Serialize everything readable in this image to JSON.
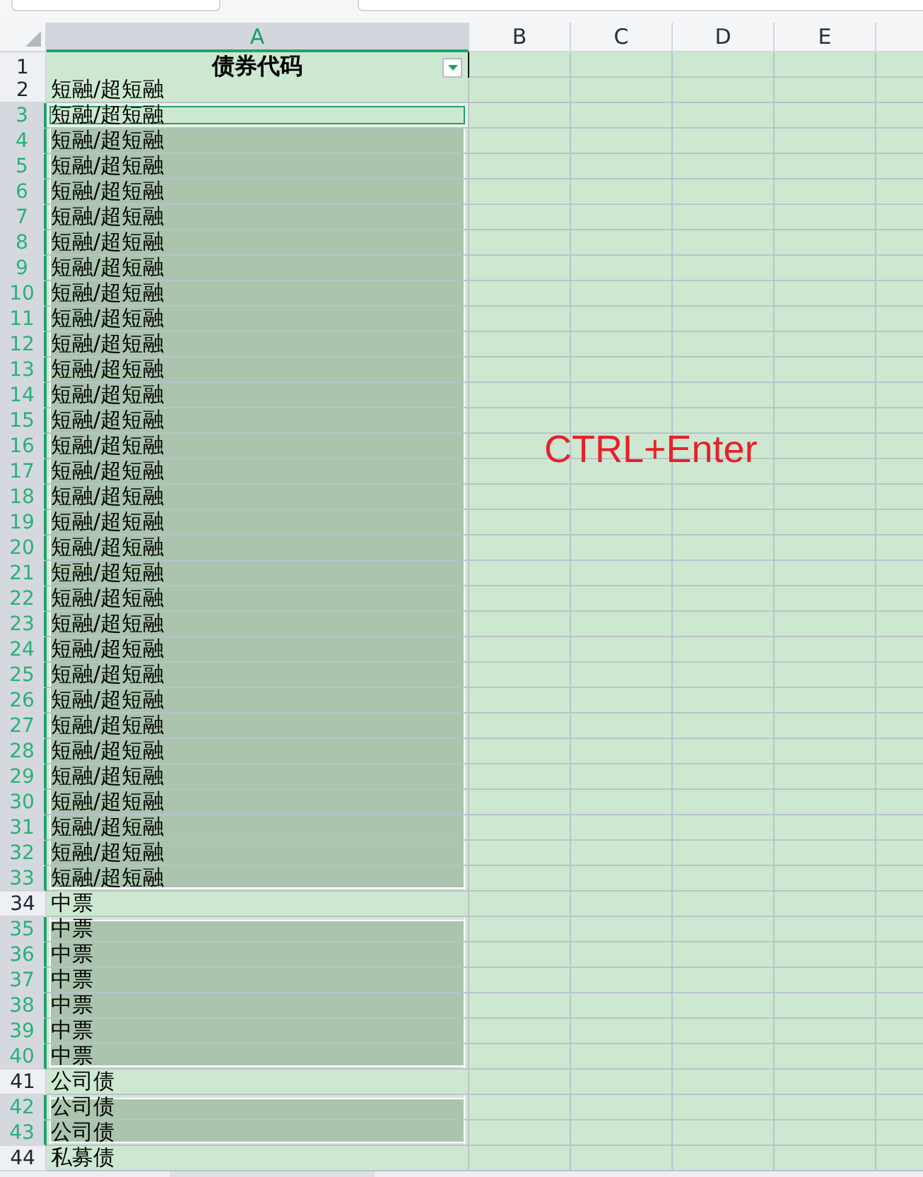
{
  "columns": [
    {
      "label": "A",
      "selected": true
    },
    {
      "label": "B",
      "selected": false
    },
    {
      "label": "C",
      "selected": false
    },
    {
      "label": "D",
      "selected": false
    },
    {
      "label": "E",
      "selected": false
    }
  ],
  "header_row": {
    "number": "1",
    "text": "债券代码",
    "filter": true
  },
  "rows": [
    {
      "number": "2",
      "value": "短融/超短融",
      "selected": false,
      "active": false
    },
    {
      "number": "3",
      "value": "短融/超短融",
      "selected": true,
      "active": true
    },
    {
      "number": "4",
      "value": "短融/超短融",
      "selected": true,
      "active": false
    },
    {
      "number": "5",
      "value": "短融/超短融",
      "selected": true,
      "active": false
    },
    {
      "number": "6",
      "value": "短融/超短融",
      "selected": true,
      "active": false
    },
    {
      "number": "7",
      "value": "短融/超短融",
      "selected": true,
      "active": false
    },
    {
      "number": "8",
      "value": "短融/超短融",
      "selected": true,
      "active": false
    },
    {
      "number": "9",
      "value": "短融/超短融",
      "selected": true,
      "active": false
    },
    {
      "number": "10",
      "value": "短融/超短融",
      "selected": true,
      "active": false
    },
    {
      "number": "11",
      "value": "短融/超短融",
      "selected": true,
      "active": false
    },
    {
      "number": "12",
      "value": "短融/超短融",
      "selected": true,
      "active": false
    },
    {
      "number": "13",
      "value": "短融/超短融",
      "selected": true,
      "active": false
    },
    {
      "number": "14",
      "value": "短融/超短融",
      "selected": true,
      "active": false
    },
    {
      "number": "15",
      "value": "短融/超短融",
      "selected": true,
      "active": false
    },
    {
      "number": "16",
      "value": "短融/超短融",
      "selected": true,
      "active": false
    },
    {
      "number": "17",
      "value": "短融/超短融",
      "selected": true,
      "active": false
    },
    {
      "number": "18",
      "value": "短融/超短融",
      "selected": true,
      "active": false
    },
    {
      "number": "19",
      "value": "短融/超短融",
      "selected": true,
      "active": false
    },
    {
      "number": "20",
      "value": "短融/超短融",
      "selected": true,
      "active": false
    },
    {
      "number": "21",
      "value": "短融/超短融",
      "selected": true,
      "active": false
    },
    {
      "number": "22",
      "value": "短融/超短融",
      "selected": true,
      "active": false
    },
    {
      "number": "23",
      "value": "短融/超短融",
      "selected": true,
      "active": false
    },
    {
      "number": "24",
      "value": "短融/超短融",
      "selected": true,
      "active": false
    },
    {
      "number": "25",
      "value": "短融/超短融",
      "selected": true,
      "active": false
    },
    {
      "number": "26",
      "value": "短融/超短融",
      "selected": true,
      "active": false
    },
    {
      "number": "27",
      "value": "短融/超短融",
      "selected": true,
      "active": false
    },
    {
      "number": "28",
      "value": "短融/超短融",
      "selected": true,
      "active": false
    },
    {
      "number": "29",
      "value": "短融/超短融",
      "selected": true,
      "active": false
    },
    {
      "number": "30",
      "value": "短融/超短融",
      "selected": true,
      "active": false
    },
    {
      "number": "31",
      "value": "短融/超短融",
      "selected": true,
      "active": false
    },
    {
      "number": "32",
      "value": "短融/超短融",
      "selected": true,
      "active": false
    },
    {
      "number": "33",
      "value": "短融/超短融",
      "selected": true,
      "active": false
    },
    {
      "number": "34",
      "value": "中票",
      "selected": false,
      "active": false
    },
    {
      "number": "35",
      "value": "中票",
      "selected": true,
      "active": false
    },
    {
      "number": "36",
      "value": "中票",
      "selected": true,
      "active": false
    },
    {
      "number": "37",
      "value": "中票",
      "selected": true,
      "active": false
    },
    {
      "number": "38",
      "value": "中票",
      "selected": true,
      "active": false
    },
    {
      "number": "39",
      "value": "中票",
      "selected": true,
      "active": false
    },
    {
      "number": "40",
      "value": "中票",
      "selected": true,
      "active": false
    },
    {
      "number": "41",
      "value": "公司债",
      "selected": false,
      "active": false
    },
    {
      "number": "42",
      "value": "公司债",
      "selected": true,
      "active": false
    },
    {
      "number": "43",
      "value": "公司债",
      "selected": true,
      "active": false
    },
    {
      "number": "44",
      "value": "私募债",
      "selected": false,
      "active": false
    }
  ],
  "note": {
    "text": "CTRL+Enter"
  }
}
